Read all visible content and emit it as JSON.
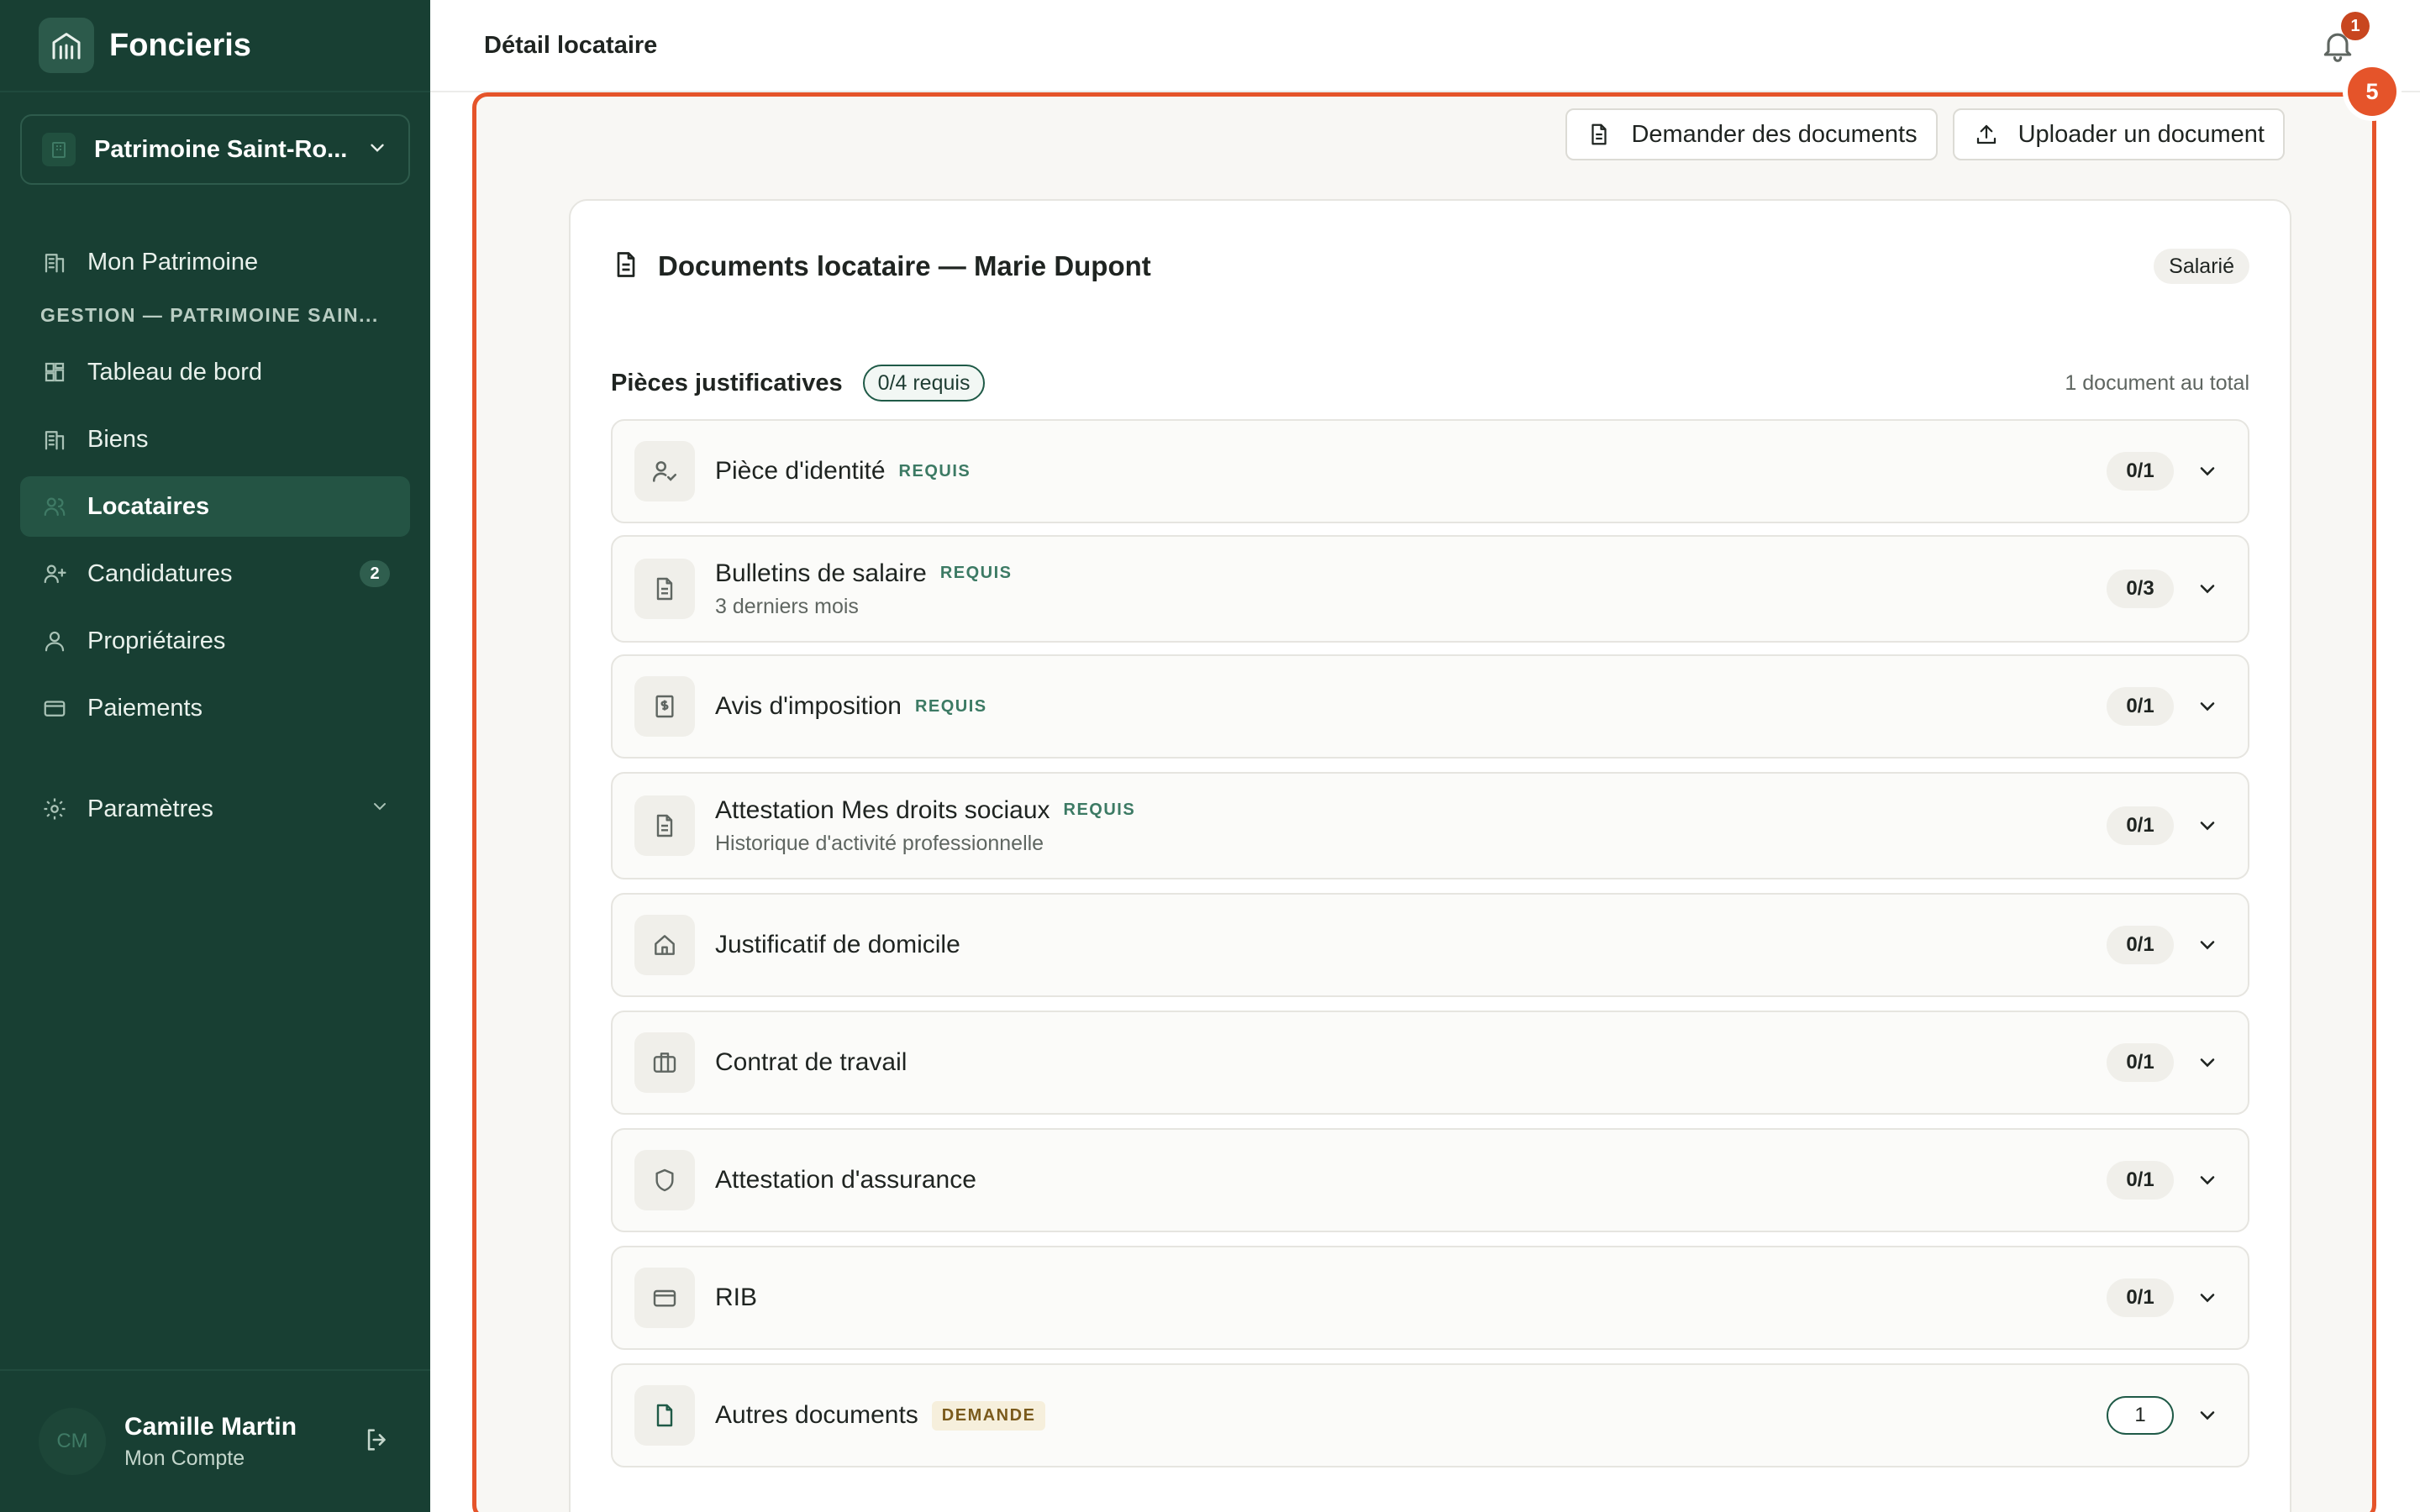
{
  "brand": {
    "name": "Foncieris",
    "logo_icon": "building-logo-icon"
  },
  "workspace": {
    "label": "Patrimoine Saint-Ro..."
  },
  "sidebar": {
    "top_item": {
      "label": "Mon Patrimoine"
    },
    "section_label": "GESTION — PATRIMOINE SAIN...",
    "items": [
      {
        "label": "Tableau de bord",
        "icon": "dashboard-icon"
      },
      {
        "label": "Biens",
        "icon": "building-icon"
      },
      {
        "label": "Locataires",
        "icon": "users-icon",
        "active": true
      },
      {
        "label": "Candidatures",
        "icon": "user-plus-icon",
        "badge": "2"
      },
      {
        "label": "Propriétaires",
        "icon": "user-icon"
      },
      {
        "label": "Paiements",
        "icon": "credit-card-icon"
      }
    ],
    "settings": {
      "label": "Paramètres"
    }
  },
  "user": {
    "initials": "CM",
    "name": "Camille Martin",
    "subtitle": "Mon Compte"
  },
  "topbar": {
    "title": "Détail locataire",
    "notification_count": "1"
  },
  "focus_badge": "5",
  "actions": {
    "request_label": "Demander des documents",
    "upload_label": "Uploader un document"
  },
  "card": {
    "title": "Documents locataire — Marie Dupont",
    "status_chip": "Salarié",
    "section_title": "Pièces justificatives",
    "required_chip": "0/4 requis",
    "total_label": "1 document au total"
  },
  "documents": [
    {
      "title": "Pièce d'identité",
      "tag": "REQUIS",
      "count": "0/1",
      "icon": "id-user-check-icon"
    },
    {
      "title": "Bulletins de salaire",
      "tag": "REQUIS",
      "subtitle": "3 derniers mois",
      "count": "0/3",
      "icon": "file-text-icon"
    },
    {
      "title": "Avis d'imposition",
      "tag": "REQUIS",
      "count": "0/1",
      "icon": "tax-receipt-icon"
    },
    {
      "title": "Attestation Mes droits sociaux",
      "tag": "REQUIS",
      "subtitle": "Historique d'activité professionnelle",
      "count": "0/1",
      "icon": "file-text-icon"
    },
    {
      "title": "Justificatif de domicile",
      "count": "0/1",
      "icon": "home-icon"
    },
    {
      "title": "Contrat de travail",
      "count": "0/1",
      "icon": "briefcase-icon"
    },
    {
      "title": "Attestation d'assurance",
      "count": "0/1",
      "icon": "shield-icon"
    },
    {
      "title": "RIB",
      "count": "0/1",
      "icon": "credit-card-icon"
    },
    {
      "title": "Autres documents",
      "tag": "DEMANDE",
      "count": "1",
      "icon": "file-icon"
    }
  ],
  "colors": {
    "sidebar_bg": "#183f33",
    "accent": "#1f5a47",
    "highlight_frame": "#e5542a",
    "notification": "#c8461f"
  }
}
